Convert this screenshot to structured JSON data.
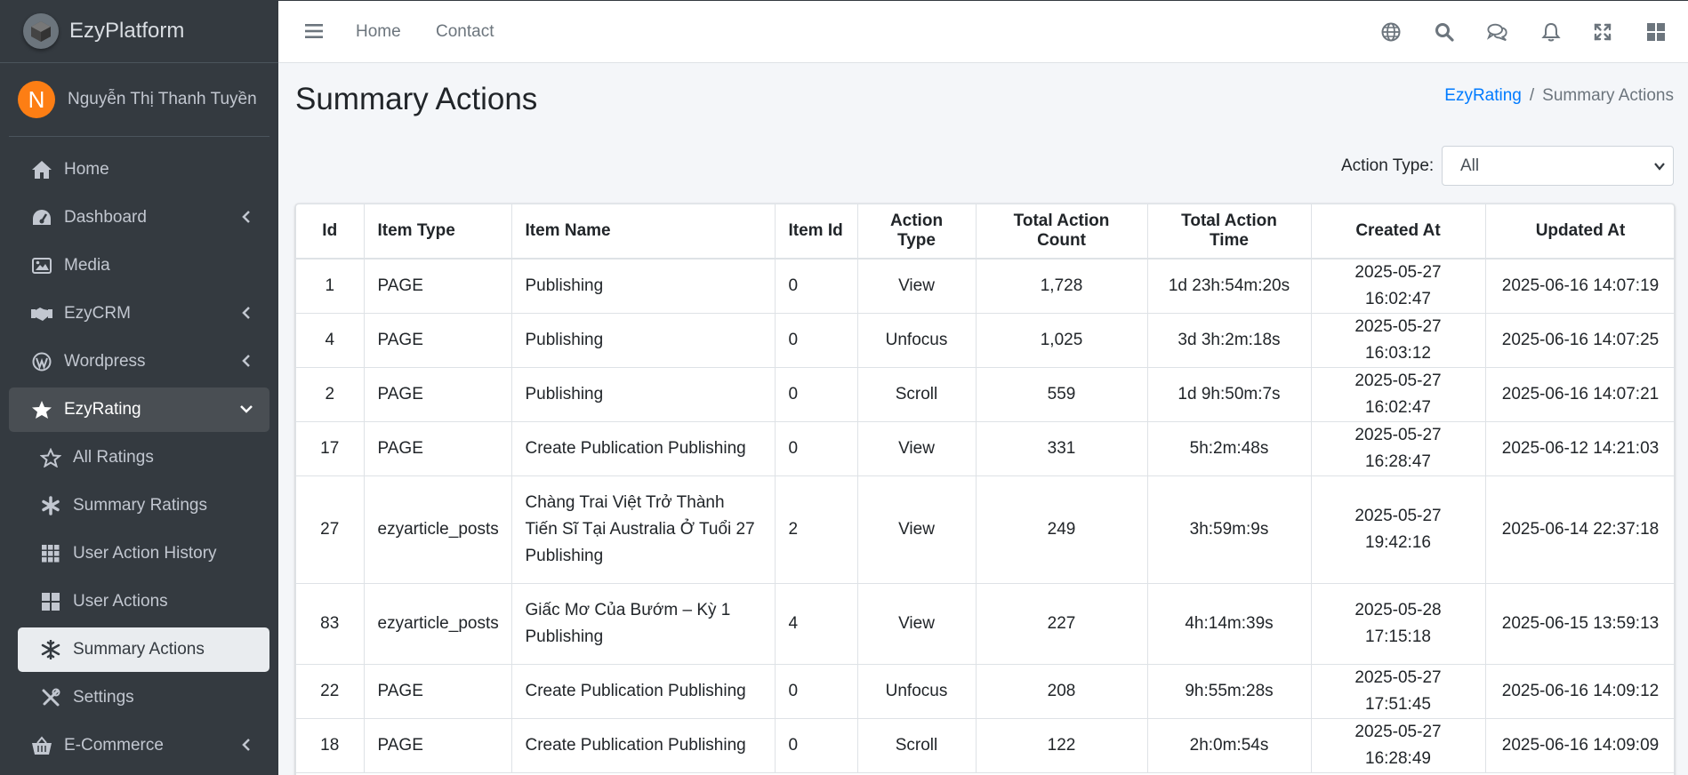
{
  "brand": {
    "name": "EzyPlatform"
  },
  "user": {
    "initial": "N",
    "name": "Nguyễn Thị Thanh Tuyền"
  },
  "sidebar": {
    "items": [
      {
        "label": "Home",
        "icon": "home-icon"
      },
      {
        "label": "Dashboard",
        "icon": "tachometer-icon"
      },
      {
        "label": "Media",
        "icon": "image-icon"
      },
      {
        "label": "EzyCRM",
        "icon": "handshake-icon"
      },
      {
        "label": "Wordpress",
        "icon": "wordpress-icon"
      },
      {
        "label": "EzyRating",
        "icon": "star-icon"
      },
      {
        "label": "All Ratings",
        "icon": "star-outline-icon"
      },
      {
        "label": "Summary Ratings",
        "icon": "asterisk-icon"
      },
      {
        "label": "User Action History",
        "icon": "grid-icon"
      },
      {
        "label": "User Actions",
        "icon": "window-grid-icon"
      },
      {
        "label": "Summary Actions",
        "icon": "snowflake-icon"
      },
      {
        "label": "Settings",
        "icon": "tools-icon"
      },
      {
        "label": "E-Commerce",
        "icon": "basket-icon"
      }
    ]
  },
  "header": {
    "links": {
      "home": "Home",
      "contact": "Contact"
    },
    "icons": [
      "globe-icon",
      "search-icon",
      "comments-icon",
      "bell-icon",
      "expand-icon",
      "grid-icon"
    ]
  },
  "page": {
    "title": "Summary Actions",
    "breadcrumb": {
      "parent": "EzyRating",
      "current": "Summary Actions"
    },
    "filter": {
      "label": "Action Type:",
      "selected": "All"
    }
  },
  "table": {
    "headers": [
      "Id",
      "Item Type",
      "Item Name",
      "Item Id",
      "Action Type",
      "Total Action Count",
      "Total Action Time",
      "Created At",
      "Updated At"
    ],
    "rows": [
      [
        "1",
        "PAGE",
        "Publishing",
        "0",
        "View",
        "1,728",
        "1d 23h:54m:20s",
        "2025-05-27 16:02:47",
        "2025-06-16 14:07:19"
      ],
      [
        "4",
        "PAGE",
        "Publishing",
        "0",
        "Unfocus",
        "1,025",
        "3d 3h:2m:18s",
        "2025-05-27 16:03:12",
        "2025-06-16 14:07:25"
      ],
      [
        "2",
        "PAGE",
        "Publishing",
        "0",
        "Scroll",
        "559",
        "1d 9h:50m:7s",
        "2025-05-27 16:02:47",
        "2025-06-16 14:07:21"
      ],
      [
        "17",
        "PAGE",
        "Create Publication Publishing",
        "0",
        "View",
        "331",
        "5h:2m:48s",
        "2025-05-27 16:28:47",
        "2025-06-12 14:21:03"
      ],
      [
        "27",
        "ezyarticle_posts",
        "Chàng Trai Việt Trở Thành Tiến Sĩ Tại Australia Ở Tuổi 27 Publishing",
        "2",
        "View",
        "249",
        "3h:59m:9s",
        "2025-05-27 19:42:16",
        "2025-06-14 22:37:18"
      ],
      [
        "83",
        "ezyarticle_posts",
        "Giấc Mơ Của Bướm – Kỳ 1 Publishing",
        "4",
        "View",
        "227",
        "4h:14m:39s",
        "2025-05-28 17:15:18",
        "2025-06-15 13:59:13"
      ],
      [
        "22",
        "PAGE",
        "Create Publication Publishing",
        "0",
        "Unfocus",
        "208",
        "9h:55m:28s",
        "2025-05-27 17:51:45",
        "2025-06-16 14:09:12"
      ],
      [
        "18",
        "PAGE",
        "Create Publication Publishing",
        "0",
        "Scroll",
        "122",
        "2h:0m:54s",
        "2025-05-27 16:28:49",
        "2025-06-16 14:09:09"
      ]
    ]
  }
}
